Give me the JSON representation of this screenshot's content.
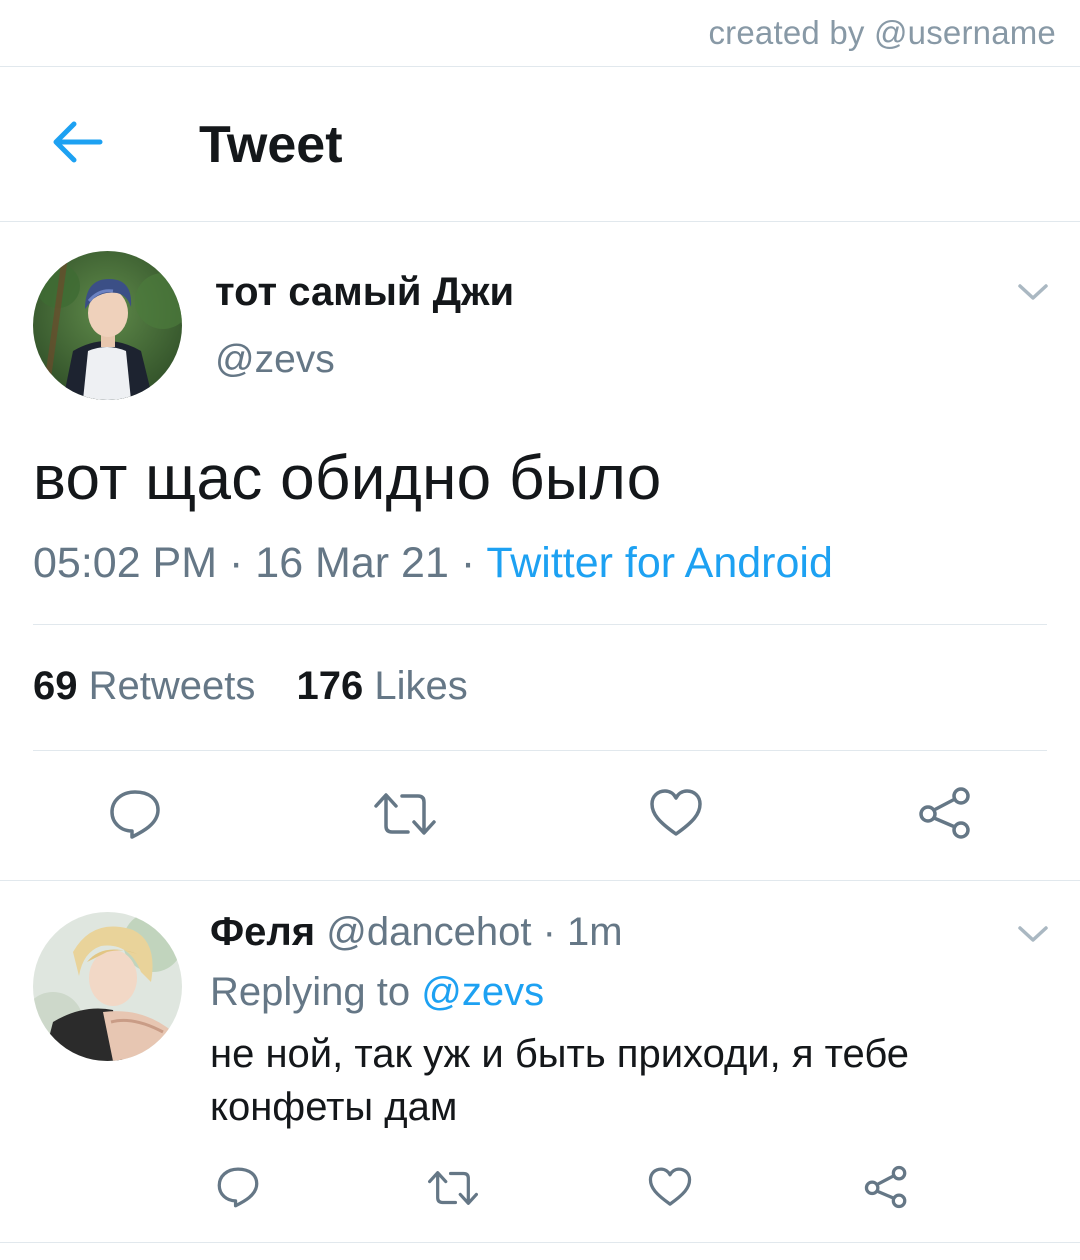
{
  "watermark": "created by @username",
  "header": {
    "title": "Tweet",
    "back_icon": "arrow-left-icon",
    "accent_color": "#1da1f2"
  },
  "tweet": {
    "display_name": "тот самый Джи",
    "handle": "@zevs",
    "text": "вот щас обидно было",
    "time": "05:02 PM",
    "date": "16 Mar 21",
    "separator": " · ",
    "source": "Twitter for Android",
    "retweets_count": "69",
    "retweets_label": "Retweets",
    "likes_count": "176",
    "likes_label": "Likes",
    "actions": [
      "reply-icon",
      "retweet-icon",
      "like-icon",
      "share-icon"
    ]
  },
  "reply": {
    "display_name": "Феля",
    "handle": "@dancehot",
    "time_ago": "1m",
    "separator": " · ",
    "replying_prefix": "Replying to",
    "replying_to": "@zevs",
    "text": "не ной, так уж и быть приходи, я тебе конфеты дам",
    "actions": [
      "reply-icon",
      "retweet-icon",
      "like-icon",
      "share-icon"
    ]
  }
}
